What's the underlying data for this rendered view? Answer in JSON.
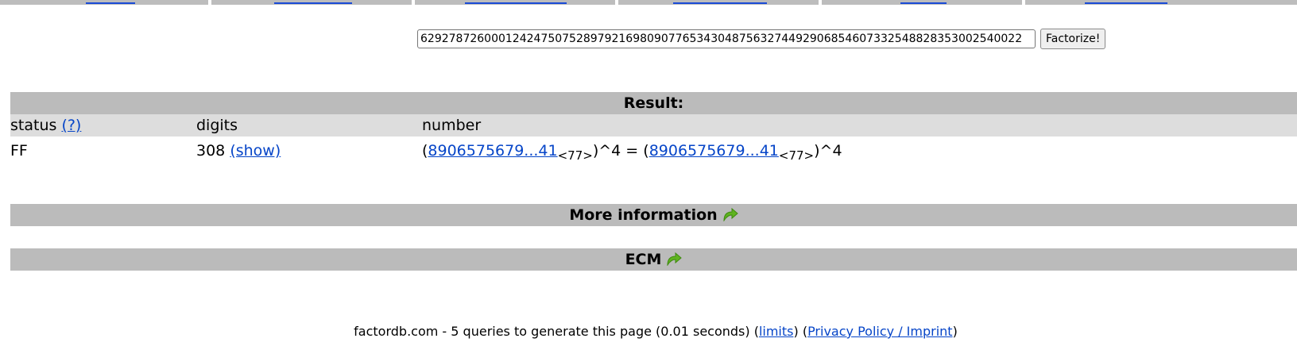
{
  "search": {
    "value": "6292787260001242475075289792169809077653430487563274492906854607332548828353002540022",
    "button_label": "Factorize!"
  },
  "result": {
    "title": "Result:",
    "columns": {
      "status": "status",
      "status_help": "(?)",
      "digits": "digits",
      "number": "number"
    },
    "row": {
      "status": "FF",
      "digits": "308",
      "show_link": "(show)",
      "lhs_open": "(",
      "lhs_link": "8906575679...41",
      "lhs_sub": "<77>",
      "lhs_close": ")^4 = (",
      "rhs_link": "8906575679...41",
      "rhs_sub": "<77>",
      "rhs_close": ")^4"
    }
  },
  "more_info": {
    "label": "More information"
  },
  "ecm": {
    "label": "ECM"
  },
  "footer": {
    "text": "factordb.com - 5 queries to generate this page (0.01 seconds) (",
    "limits": "limits",
    "mid": ") (",
    "privacy": "Privacy Policy / Imprint",
    "end": ")"
  },
  "colors": {
    "section_bar": "#bbbbbb",
    "header_row": "#dddddd",
    "link": "#0645c8",
    "arrow": "#5fb31f"
  },
  "icons": [
    "arrow-forward-icon"
  ]
}
